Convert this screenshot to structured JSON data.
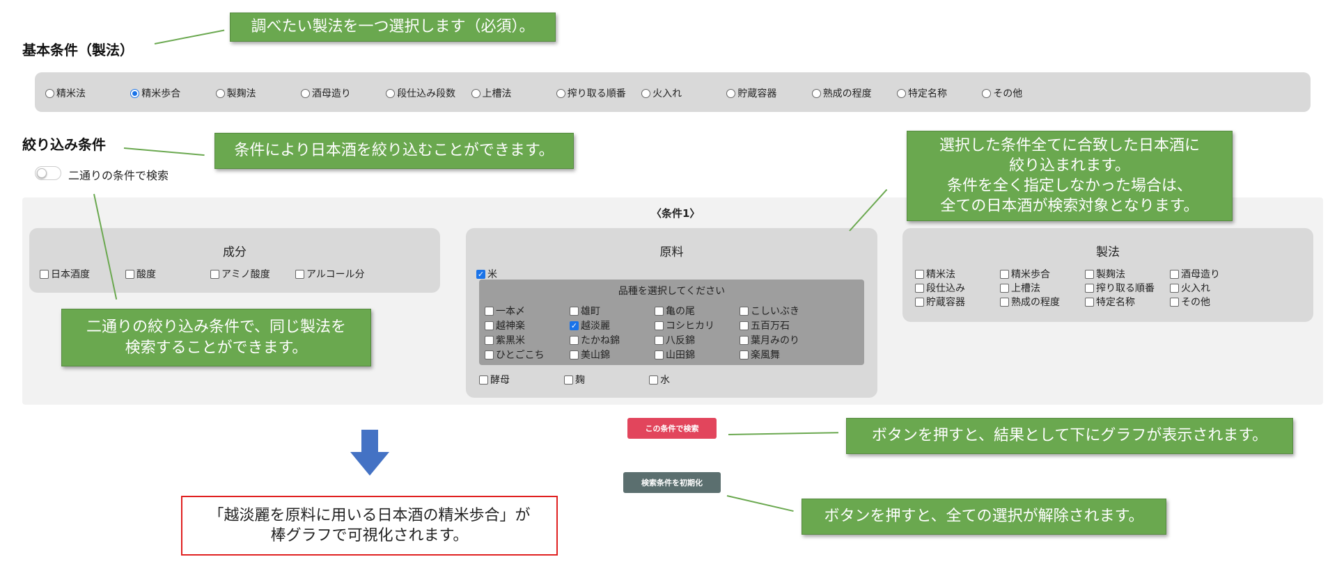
{
  "header": {
    "basic_title": "基本条件（製法）",
    "filter_title": "絞り込み条件"
  },
  "callouts": {
    "select_method": "調べたい製法を一つ選択します（必須）。",
    "filter_info": "条件により日本酒を絞り込むことができます。",
    "match_all": "選択した条件全てに合致した日本酒に\n絞り込まれます。\n条件を全く指定しなかった場合は、\n全ての日本酒が検索対象となります。",
    "two_conditions": "二通りの絞り込み条件で、同じ製法を\n検索することができます。",
    "search_btn_info": "ボタンを押すと、結果として下にグラフが表示されます。",
    "reset_btn_info": "ボタンを押すと、全ての選択が解除されます。",
    "result_note": "「越淡麗を原料に用いる日本酒の精米歩合」が\n棒グラフで可視化されます。"
  },
  "methods": {
    "options": [
      "精米法",
      "精米歩合",
      "製麹法",
      "酒母造り",
      "段仕込み段数",
      "上槽法",
      "搾り取る順番",
      "火入れ",
      "貯蔵容器",
      "熟成の程度",
      "特定名称",
      "その他"
    ],
    "selected": "精米歩合"
  },
  "toggle": {
    "label": "二通りの条件で検索",
    "on": false
  },
  "condition1": {
    "heading": "〈条件1〉",
    "component": {
      "title": "成分",
      "items": [
        "日本酒度",
        "酸度",
        "アミノ酸度",
        "アルコール分"
      ]
    },
    "material": {
      "title": "原料",
      "rice_label": "米",
      "rice_checked": true,
      "variety_prompt": "品種を選択してください",
      "varieties": [
        "一本〆",
        "雄町",
        "亀の尾",
        "こしいぶき",
        "越神楽",
        "越淡麗",
        "コシヒカリ",
        "五百万石",
        "紫黒米",
        "たかね錦",
        "八反錦",
        "葉月みのり",
        "ひとごこち",
        "美山錦",
        "山田錦",
        "楽風舞"
      ],
      "variety_checked": "越淡麗",
      "others": [
        "酵母",
        "麹",
        "水"
      ]
    },
    "process": {
      "title": "製法",
      "items": [
        "精米法",
        "精米歩合",
        "製麹法",
        "酒母造り",
        "段仕込み",
        "上槽法",
        "搾り取る順番",
        "火入れ",
        "貯蔵容器",
        "熟成の程度",
        "特定名称",
        "その他"
      ]
    }
  },
  "buttons": {
    "search": "この条件で検索",
    "reset": "検索条件を初期化",
    "search_color": "#e2455c",
    "reset_color": "#5b6f6f"
  },
  "colors": {
    "callout": "#6aa84f",
    "arrow": "#4472c4",
    "note_border": "#e02020"
  },
  "icons": {
    "down_arrow": "down-arrow-icon"
  }
}
